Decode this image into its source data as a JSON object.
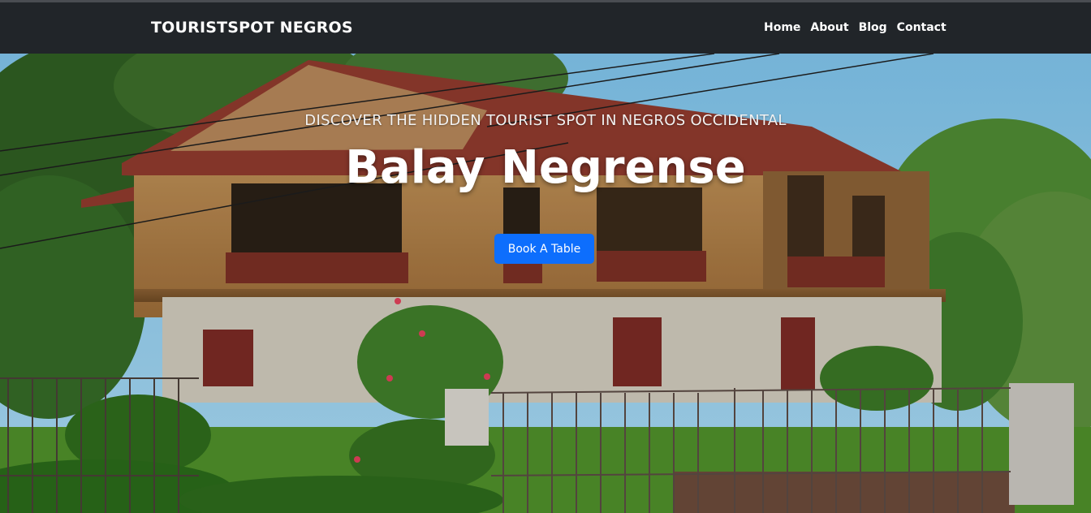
{
  "navbar": {
    "brand": "TOURISTSPOT NEGROS",
    "links": [
      "Home",
      "About",
      "Blog",
      "Contact"
    ]
  },
  "hero": {
    "eyebrow": "DISCOVER THE HIDDEN TOURIST SPOT IN NEGROS OCCIDENTAL",
    "title": "Balay Negrense",
    "cta_label": "Book A Table"
  },
  "colors": {
    "navbar_bg": "#212529",
    "cta_bg": "#0d6efd",
    "text": "#ffffff"
  }
}
